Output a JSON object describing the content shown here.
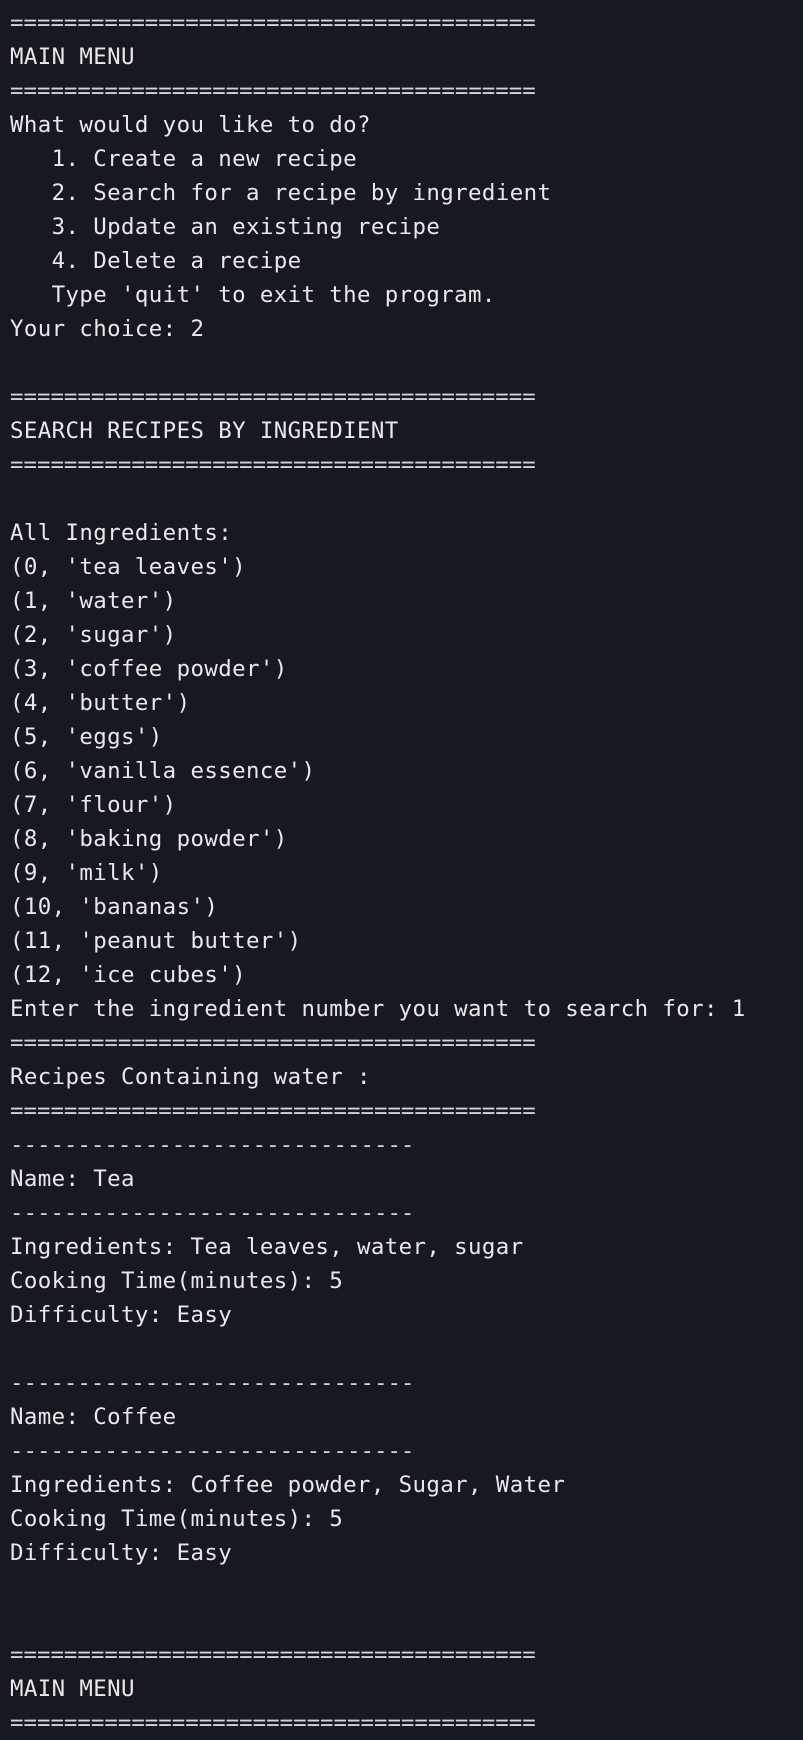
{
  "terminal": {
    "lines": [
      "=======================================",
      "MAIN MENU",
      "=======================================",
      "What would you like to do?",
      "   1. Create a new recipe",
      "   2. Search for a recipe by ingredient",
      "   3. Update an existing recipe",
      "   4. Delete a recipe",
      "   Type 'quit' to exit the program.",
      "Your choice: 2",
      "",
      "=======================================",
      "SEARCH RECIPES BY INGREDIENT",
      "=======================================",
      "",
      "All Ingredients:",
      "(0, 'tea leaves')",
      "(1, 'water')",
      "(2, 'sugar')",
      "(3, 'coffee powder')",
      "(4, 'butter')",
      "(5, 'eggs')",
      "(6, 'vanilla essence')",
      "(7, 'flour')",
      "(8, 'baking powder')",
      "(9, 'milk')",
      "(10, 'bananas')",
      "(11, 'peanut butter')",
      "(12, 'ice cubes')",
      "Enter the ingredient number you want to search for: 1",
      "=======================================",
      "Recipes Containing water :",
      "=======================================",
      "------------------------------",
      "Name: Tea",
      "------------------------------",
      "Ingredients: Tea leaves, water, sugar",
      "Cooking Time(minutes): 5",
      "Difficulty: Easy",
      "",
      "------------------------------",
      "Name: Coffee",
      "------------------------------",
      "Ingredients: Coffee powder, Sugar, Water",
      "Cooking Time(minutes): 5",
      "Difficulty: Easy",
      "",
      "",
      "=======================================",
      "MAIN MENU",
      "======================================="
    ]
  }
}
